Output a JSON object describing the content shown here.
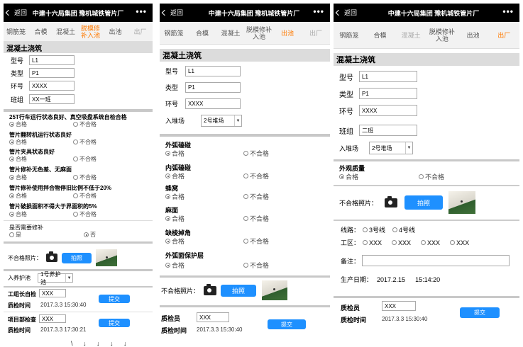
{
  "app": {
    "back_label": "返回",
    "title": "中建十六局集团 豫机城铁管片厂",
    "menu": "•••"
  },
  "phone1": {
    "tabs": [
      "钢筋笼",
      "合模",
      "混凝土",
      "脱模修补入池",
      "出池",
      "出厂"
    ],
    "section": "混凝土浇筑",
    "fields": [
      {
        "label": "型号",
        "value": "L1"
      },
      {
        "label": "类型",
        "value": "P1"
      },
      {
        "label": "环号",
        "value": "XXXX"
      },
      {
        "label": "班组",
        "value": "XX一班"
      }
    ],
    "checks": [
      {
        "title": "25T行车运行状态良好、真空吸盘系统自检合格",
        "ok": "合格",
        "bad": "不合格"
      },
      {
        "title": "管片翻转机运行状态良好",
        "ok": "合格",
        "bad": "不合格"
      },
      {
        "title": "管片夹具状态良好",
        "ok": "合格",
        "bad": "不合格"
      },
      {
        "title": "管片修补无色差、无麻面",
        "ok": "合格",
        "bad": "不合格"
      },
      {
        "title": "管片修补使用拌合物停旧比例不低于20%",
        "ok": "合格",
        "bad": "不合格"
      },
      {
        "title": "管片破损面积不得大于界面积的5%",
        "ok": "合格",
        "bad": "不合格"
      }
    ],
    "repair": {
      "title": "是否需要修补",
      "yes": "是",
      "no": "否"
    },
    "photo_label": "不合格照片：",
    "photo_button": "拍照",
    "pool_label": "入养护池",
    "pool_value": "1号养护池",
    "sign1": {
      "label": "工组长自检",
      "value": "XXX",
      "time_label": "质检时间",
      "time": "2017.3.3  15:30:40",
      "submit": "提交"
    },
    "sign2": {
      "label": "项目部检查",
      "value": "XXX",
      "time_label": "质检时间",
      "time": "2017.3.3  17:30:21",
      "submit": "提交"
    }
  },
  "phone2": {
    "tabs": [
      "钢筋笼",
      "合模",
      "混凝土",
      "脱模修补入池",
      "出池",
      "出厂"
    ],
    "section": "混凝土浇筑",
    "fields": [
      {
        "label": "型号",
        "value": "L1"
      },
      {
        "label": "类型",
        "value": "P1"
      },
      {
        "label": "环号",
        "value": "XXXX"
      }
    ],
    "yard_label": "入堆场",
    "yard_value": "2号堆场",
    "checks": [
      {
        "title": "外弧磕碰",
        "ok": "合格",
        "bad": "不合格"
      },
      {
        "title": "内弧磕碰",
        "ok": "合格",
        "bad": "不合格"
      },
      {
        "title": "蜂窝",
        "ok": "合格",
        "bad": "不合格"
      },
      {
        "title": "麻面",
        "ok": "合格",
        "bad": "不合格"
      },
      {
        "title": "缺棱掉角",
        "ok": "合格",
        "bad": "不合格"
      },
      {
        "title": "外弧面保护层",
        "ok": "合格",
        "bad": "不合格"
      }
    ],
    "photo_label": "不合格照片：",
    "photo_button": "拍照",
    "inspector_label": "质检员",
    "inspector_value": "XXX",
    "time_label": "质检时间",
    "time": "2017.3.3  15:30:40",
    "submit": "提交"
  },
  "phone3": {
    "tabs": [
      "钢筋笼",
      "合模",
      "混凝土",
      "脱模修补入池",
      "出池",
      "出厂"
    ],
    "section": "混凝土浇筑",
    "fields": [
      {
        "label": "型号",
        "value": "L1"
      },
      {
        "label": "类型",
        "value": "P1"
      },
      {
        "label": "环号",
        "value": "XXXX"
      },
      {
        "label": "班组",
        "value": "二班"
      }
    ],
    "yard_label": "入堆场",
    "yard_value": "2号堆场",
    "check": {
      "title": "外观质量",
      "ok": "合格",
      "bad": "不合格"
    },
    "photo_label": "不合格照片：",
    "photo_button": "拍照",
    "line_label": "线路：",
    "lines": [
      "3号线",
      "4号线"
    ],
    "site_label": "工区：",
    "sites": [
      "XXX",
      "XXX",
      "XXX",
      "XXX"
    ],
    "note_label": "备注：",
    "date_label": "生产日期：",
    "date_value": "2017.2.15",
    "time_value": "15:14:20",
    "inspector_label": "质检员",
    "inspector_value": "XXX",
    "time_label": "质检时间",
    "time": "2017.3.3  15:30:40",
    "submit": "提交"
  },
  "footer_chars": "\\ ↓ ↓ ↓ ↓"
}
